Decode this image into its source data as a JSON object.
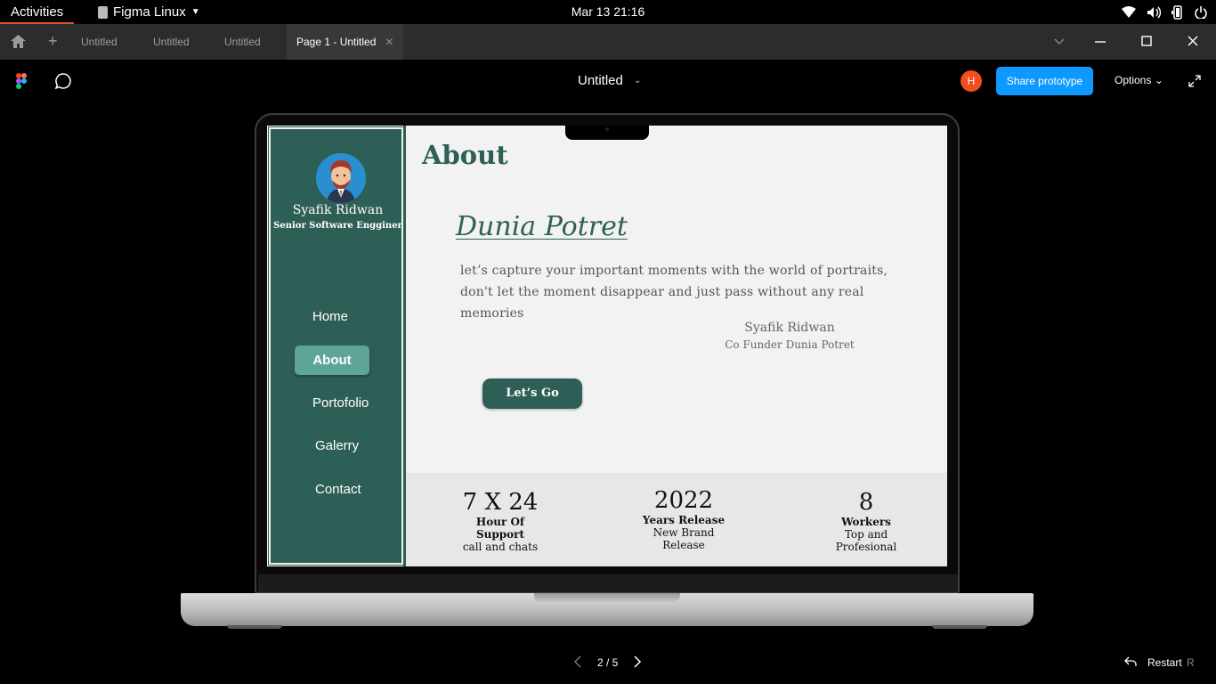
{
  "topbar": {
    "activities": "Activities",
    "app_name": "Figma Linux",
    "clock": "Mar 13  21:16",
    "tray_icons": [
      "wifi-icon",
      "volume-icon",
      "battery-icon",
      "power-icon"
    ]
  },
  "tabs": {
    "items": [
      {
        "label": "Untitled"
      },
      {
        "label": "Untitled"
      },
      {
        "label": "Untitled"
      },
      {
        "label": "Page 1 - Untitled"
      }
    ],
    "active_index": 3
  },
  "toolbar": {
    "doc_title": "Untitled",
    "user_initial": "H",
    "share_label": "Share prototype",
    "options_label": "Options"
  },
  "site": {
    "profile": {
      "name": "Syafik Ridwan",
      "role": "Senior Software Engginer"
    },
    "nav": [
      "Home",
      "About",
      "Portofolio",
      "Galerry",
      "Contact"
    ],
    "active_nav": "About",
    "page_title": "About",
    "hero": {
      "title": "Dunia Potret",
      "body": "let’s capture your important moments with the world of portraits, don't let the moment disappear and just pass without any real memories",
      "quote_name": "Syafik Ridwan",
      "quote_role": "Co Funder Dunia Potret",
      "cta": "Let’s Go"
    },
    "stats": [
      {
        "number": "7 X 24",
        "label": "Hour Of Support",
        "sub": "call and chats"
      },
      {
        "number": "2022",
        "label": "Years Release",
        "sub": "New Brand Release"
      },
      {
        "number": "8",
        "label": "Workers",
        "sub": "Top and Profesional"
      }
    ]
  },
  "pager": {
    "text": "2 / 5",
    "restart_label": "Restart",
    "restart_key": "R"
  },
  "colors": {
    "brand_green": "#2e5f56",
    "nav_active": "#5fa597",
    "share_blue": "#0d99ff",
    "avatar_orange": "#f24e1e",
    "activities_underline": "#e95420"
  }
}
